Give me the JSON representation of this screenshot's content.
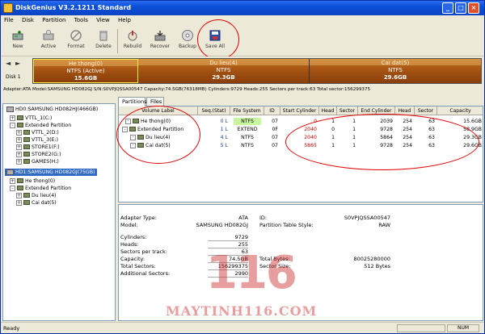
{
  "window": {
    "title": "DiskGenius V3.2.1211 Standard",
    "min": "_",
    "max": "□",
    "close": "×"
  },
  "menu": [
    "File",
    "Disk",
    "Partition",
    "Tools",
    "View",
    "Help"
  ],
  "toolbar": {
    "buttons": [
      {
        "label": "New",
        "icon": "new-partition-icon"
      },
      {
        "label": "Active",
        "icon": "active-icon"
      },
      {
        "label": "Format",
        "icon": "format-icon"
      },
      {
        "label": "Delete",
        "icon": "delete-icon"
      },
      {
        "label": "Rebuild",
        "icon": "rebuild-icon"
      },
      {
        "label": "Recover",
        "icon": "recover-icon"
      },
      {
        "label": "Backup",
        "icon": "backup-icon"
      },
      {
        "label": "Save All",
        "icon": "save-all-icon"
      }
    ]
  },
  "diskmap": {
    "disk_label": "Disk 1",
    "nav_left": "◄",
    "nav_right": "►",
    "partitions": [
      {
        "name": "He thong(0)",
        "fs": "NTFS (Active)",
        "size": "15.6GB"
      },
      {
        "name": "Du lieu(4)",
        "fs": "NTFS",
        "size": "29.3GB"
      },
      {
        "name": "Cai dat(5)",
        "fs": "NTFS",
        "size": "29.6GB"
      }
    ]
  },
  "infoline": "Adapter:ATA  Model:SAMSUNG HD082GJ  S/N:S0VPJQSSA00547  Capacity:74.5GB(76318MB)  Cylinders:9729  Heads:255  Sectors per track:63  Total sector:156299375",
  "tree": {
    "nodes": [
      {
        "label": "HD0:SAMSUNG HD082HJ(466GB)",
        "type": "disk"
      },
      {
        "label": "VTTL_1(C:)",
        "type": "part"
      },
      {
        "label": "Extended Partition",
        "type": "ext"
      },
      {
        "label": "VTTL_2(D:)",
        "type": "part"
      },
      {
        "label": "VTTL_3(E:)",
        "type": "part"
      },
      {
        "label": "STORE1(F:)",
        "type": "part"
      },
      {
        "label": "STORE2(G:)",
        "type": "part"
      },
      {
        "label": "GAMES(H:)",
        "type": "part"
      },
      {
        "label": "HD1:SAMSUNG HD082GJ(75GB)",
        "type": "disk-selected"
      },
      {
        "label": "He thong(0)",
        "type": "part"
      },
      {
        "label": "Extended Partition",
        "type": "ext"
      },
      {
        "label": "Du lieu(4)",
        "type": "part"
      },
      {
        "label": "Cai dat(5)",
        "type": "part"
      }
    ]
  },
  "tabs": [
    "Partitions",
    "Files"
  ],
  "grid": {
    "headers": [
      "Volume Label",
      "Seq.(Stat)",
      "File System",
      "ID",
      "Start Cylinder",
      "Head",
      "Sector",
      "End Cylinder",
      "Head",
      "Sector",
      "Capacity"
    ],
    "rows": [
      {
        "label": "He thong(0)",
        "seq": "0  L",
        "fs": "NTFS",
        "id": "07",
        "sc": "0",
        "sh": "1",
        "ss": "1",
        "ec": "2039",
        "eh": "254",
        "es": "63",
        "cap": "15.6GB"
      },
      {
        "label": "Extended Partition",
        "seq": "1  L",
        "fs": "EXTEND",
        "id": "0F",
        "sc": "2040",
        "sh": "0",
        "ss": "1",
        "ec": "9728",
        "eh": "254",
        "es": "63",
        "cap": "58.9GB"
      },
      {
        "label": "Du lieu(4)",
        "seq": "4  L",
        "fs": "NTFS",
        "id": "07",
        "sc": "2040",
        "sh": "1",
        "ss": "1",
        "ec": "5864",
        "eh": "254",
        "es": "63",
        "cap": "29.3GB"
      },
      {
        "label": "Cai dat(5)",
        "seq": "5  L",
        "fs": "NTFS",
        "id": "07",
        "sc": "5865",
        "sh": "1",
        "ss": "1",
        "ec": "9728",
        "eh": "254",
        "es": "63",
        "cap": "29.6GB"
      }
    ]
  },
  "details": {
    "adapter_type_label": "Adapter Type:",
    "adapter_type": "ATA",
    "id_label": "ID:",
    "id": "S0VPJQSSA00547",
    "model_label": "Model:",
    "model": "SAMSUNG HD082GJ",
    "pts_label": "Partition Table Style:",
    "pts": "RAW",
    "cylinders_label": "Cylinders:",
    "cylinders": "9729",
    "heads_label": "Heads:",
    "heads": "255",
    "spt_label": "Sectors per track:",
    "spt": "63",
    "capacity_label": "Capacity:",
    "capacity": "74.5GB",
    "total_bytes_label": "Total Bytes:",
    "total_bytes": "80025280000",
    "total_sectors_label": "Total Sectors:",
    "total_sectors": "156299375",
    "sector_size_label": "Sector Size:",
    "sector_size": "512 Bytes",
    "additional_label": "Additional Sectors:",
    "additional": "2990"
  },
  "watermark": {
    "number": "116",
    "site": "MAYTINH116.COM"
  },
  "status": {
    "text": "Ready",
    "num": "NUM"
  },
  "colors": {
    "accent_red": "#e00000",
    "partition_brown": "#a04f10",
    "selection_blue": "#316ac5"
  }
}
